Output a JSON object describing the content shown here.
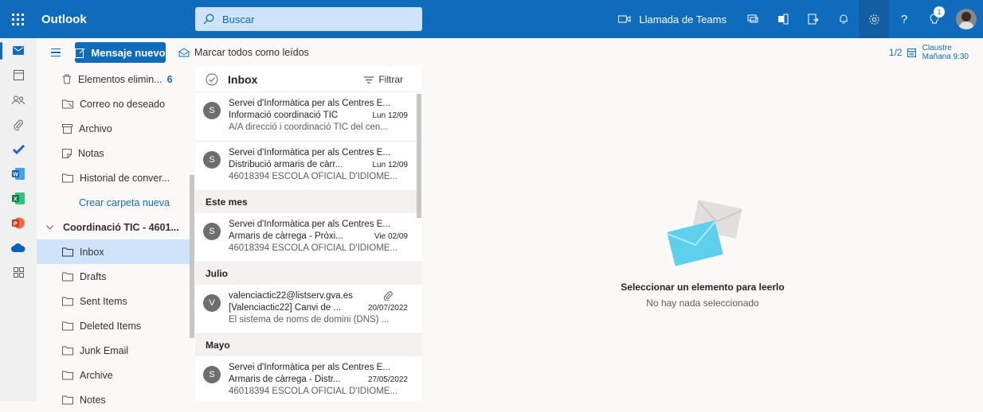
{
  "app": {
    "title": "Outlook"
  },
  "search": {
    "placeholder": "Buscar"
  },
  "topbar": {
    "teams_label": "Llamada de Teams",
    "tips_badge": "1"
  },
  "toolbar": {
    "new_message_label": "Mensaje nuevo",
    "mark_all_read_label": "Marcar todos como leídos",
    "reminder_count": "1/2",
    "reminder_title": "Claustre",
    "reminder_time": "Mañana 9:30"
  },
  "rail": {
    "icons": [
      "mail-icon",
      "calendar-icon",
      "people-icon",
      "attach-icon",
      "todo-icon",
      "word-icon",
      "excel-icon",
      "powerpoint-icon",
      "onedrive-icon",
      "apps-icon"
    ]
  },
  "folders": {
    "deleted_label": "Elementos elimin...",
    "deleted_count": "6",
    "junk_label": "Correo no deseado",
    "archive_label": "Archivo",
    "notes_label": "Notas",
    "history_label": "Historial de conver...",
    "create_folder_label": "Crear carpeta nueva",
    "group_label": "Coordinació TIC - 4601...",
    "group_items": [
      "Inbox",
      "Drafts",
      "Sent Items",
      "Deleted Items",
      "Junk Email",
      "Archive",
      "Notes"
    ]
  },
  "list": {
    "title": "Inbox",
    "filter_label": "Filtrar",
    "sections": [
      "Este mes",
      "Julio",
      "Mayo"
    ],
    "mails": [
      {
        "avatar": "S",
        "from": "Servei d'Informàtica per als Centres E...",
        "subject": "Informació coordinació TIC",
        "date": "Lun 12/09",
        "preview": "A/A direcció i coordinació TIC del cen..."
      },
      {
        "avatar": "S",
        "from": "Servei d'Informàtica per als Centres E...",
        "subject": "Distribució armaris de càrr...",
        "date": "Lun 12/09",
        "preview": "46018394 ESCOLA OFICIAL D'IDIOME..."
      },
      {
        "avatar": "S",
        "from": "Servei d'Informàtica per als Centres E...",
        "subject": "Armaris de càrrega - Pròxi...",
        "date": "Vie 02/09",
        "preview": "46018394 ESCOLA OFICIAL D'IDIOME..."
      },
      {
        "avatar": "V",
        "from": "valenciactic22@listserv.gva.es",
        "subject": "[Valenciactic22] Canvi de ...",
        "date": "20/07/2022",
        "preview": "El sistema de noms de domini (DNS) ..."
      },
      {
        "avatar": "S",
        "from": "Servei d'Informàtica per als Centres E...",
        "subject": "Armaris de càrrega - Distr...",
        "date": "27/05/2022",
        "preview": "46018394 ESCOLA OFICIAL D'IDIOME..."
      }
    ]
  },
  "reading": {
    "empty_title": "Seleccionar un elemento para leerlo",
    "empty_subtitle": "No hay nada seleccionado"
  },
  "colors": {
    "brand": "#0f6cbd",
    "selected": "#cfe4fa"
  }
}
